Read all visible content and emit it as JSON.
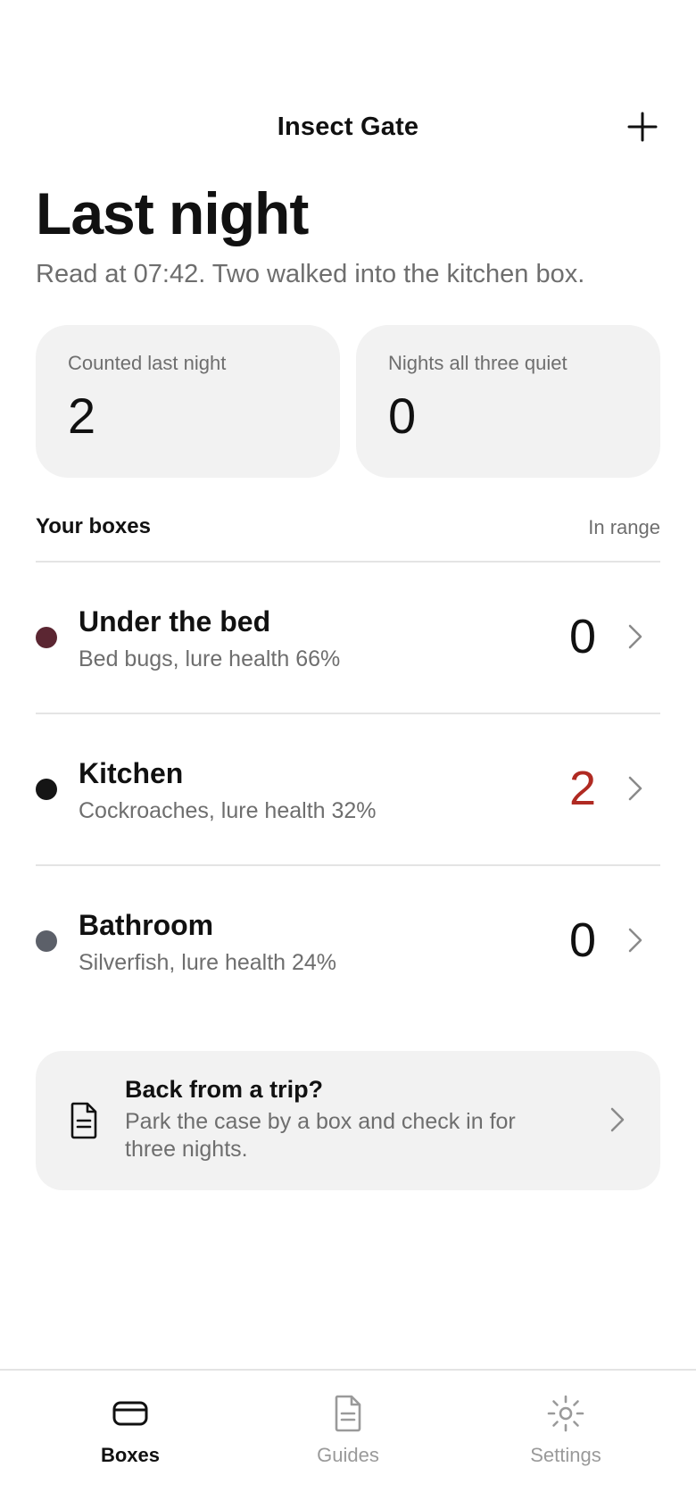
{
  "header": {
    "title": "Insect Gate",
    "add_icon": "plus-icon"
  },
  "hero": {
    "title": "Last night",
    "subtitle": "Read at 07:42. Two walked into the kitchen box."
  },
  "stats": [
    {
      "label": "Counted last night",
      "value": "2"
    },
    {
      "label": "Nights all three quiet",
      "value": "0"
    }
  ],
  "boxes_section": {
    "title": "Your boxes",
    "aside": "In range"
  },
  "boxes": [
    {
      "name": "Under the bed",
      "desc": "Bed bugs, lure health 66%",
      "count": "0",
      "dot_color": "#5b2632",
      "count_color": "#111111"
    },
    {
      "name": "Kitchen",
      "desc": "Cockroaches, lure health 32%",
      "count": "2",
      "dot_color": "#151515",
      "count_color": "#b02a22"
    },
    {
      "name": "Bathroom",
      "desc": "Silverfish, lure health 24%",
      "count": "0",
      "dot_color": "#5c6069",
      "count_color": "#111111"
    }
  ],
  "trip_card": {
    "title": "Back from a trip?",
    "body": "Park the case by a box and check in for three nights.",
    "icon": "document-icon"
  },
  "tabs": [
    {
      "label": "Boxes",
      "icon": "box-icon",
      "active": true
    },
    {
      "label": "Guides",
      "icon": "document-icon",
      "active": false
    },
    {
      "label": "Settings",
      "icon": "sun-gear-icon",
      "active": false
    }
  ],
  "colors": {
    "card_bg": "#f2f2f2",
    "muted_text": "#6e6e6e",
    "alert": "#b02a22"
  }
}
